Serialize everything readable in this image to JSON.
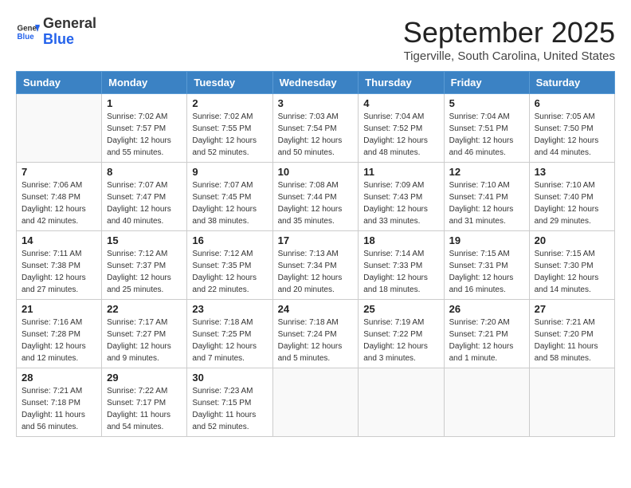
{
  "header": {
    "logo_general": "General",
    "logo_blue": "Blue",
    "month_title": "September 2025",
    "location": "Tigerville, South Carolina, United States"
  },
  "days_of_week": [
    "Sunday",
    "Monday",
    "Tuesday",
    "Wednesday",
    "Thursday",
    "Friday",
    "Saturday"
  ],
  "weeks": [
    [
      {
        "day": "",
        "info": ""
      },
      {
        "day": "1",
        "info": "Sunrise: 7:02 AM\nSunset: 7:57 PM\nDaylight: 12 hours\nand 55 minutes."
      },
      {
        "day": "2",
        "info": "Sunrise: 7:02 AM\nSunset: 7:55 PM\nDaylight: 12 hours\nand 52 minutes."
      },
      {
        "day": "3",
        "info": "Sunrise: 7:03 AM\nSunset: 7:54 PM\nDaylight: 12 hours\nand 50 minutes."
      },
      {
        "day": "4",
        "info": "Sunrise: 7:04 AM\nSunset: 7:52 PM\nDaylight: 12 hours\nand 48 minutes."
      },
      {
        "day": "5",
        "info": "Sunrise: 7:04 AM\nSunset: 7:51 PM\nDaylight: 12 hours\nand 46 minutes."
      },
      {
        "day": "6",
        "info": "Sunrise: 7:05 AM\nSunset: 7:50 PM\nDaylight: 12 hours\nand 44 minutes."
      }
    ],
    [
      {
        "day": "7",
        "info": "Sunrise: 7:06 AM\nSunset: 7:48 PM\nDaylight: 12 hours\nand 42 minutes."
      },
      {
        "day": "8",
        "info": "Sunrise: 7:07 AM\nSunset: 7:47 PM\nDaylight: 12 hours\nand 40 minutes."
      },
      {
        "day": "9",
        "info": "Sunrise: 7:07 AM\nSunset: 7:45 PM\nDaylight: 12 hours\nand 38 minutes."
      },
      {
        "day": "10",
        "info": "Sunrise: 7:08 AM\nSunset: 7:44 PM\nDaylight: 12 hours\nand 35 minutes."
      },
      {
        "day": "11",
        "info": "Sunrise: 7:09 AM\nSunset: 7:43 PM\nDaylight: 12 hours\nand 33 minutes."
      },
      {
        "day": "12",
        "info": "Sunrise: 7:10 AM\nSunset: 7:41 PM\nDaylight: 12 hours\nand 31 minutes."
      },
      {
        "day": "13",
        "info": "Sunrise: 7:10 AM\nSunset: 7:40 PM\nDaylight: 12 hours\nand 29 minutes."
      }
    ],
    [
      {
        "day": "14",
        "info": "Sunrise: 7:11 AM\nSunset: 7:38 PM\nDaylight: 12 hours\nand 27 minutes."
      },
      {
        "day": "15",
        "info": "Sunrise: 7:12 AM\nSunset: 7:37 PM\nDaylight: 12 hours\nand 25 minutes."
      },
      {
        "day": "16",
        "info": "Sunrise: 7:12 AM\nSunset: 7:35 PM\nDaylight: 12 hours\nand 22 minutes."
      },
      {
        "day": "17",
        "info": "Sunrise: 7:13 AM\nSunset: 7:34 PM\nDaylight: 12 hours\nand 20 minutes."
      },
      {
        "day": "18",
        "info": "Sunrise: 7:14 AM\nSunset: 7:33 PM\nDaylight: 12 hours\nand 18 minutes."
      },
      {
        "day": "19",
        "info": "Sunrise: 7:15 AM\nSunset: 7:31 PM\nDaylight: 12 hours\nand 16 minutes."
      },
      {
        "day": "20",
        "info": "Sunrise: 7:15 AM\nSunset: 7:30 PM\nDaylight: 12 hours\nand 14 minutes."
      }
    ],
    [
      {
        "day": "21",
        "info": "Sunrise: 7:16 AM\nSunset: 7:28 PM\nDaylight: 12 hours\nand 12 minutes."
      },
      {
        "day": "22",
        "info": "Sunrise: 7:17 AM\nSunset: 7:27 PM\nDaylight: 12 hours\nand 9 minutes."
      },
      {
        "day": "23",
        "info": "Sunrise: 7:18 AM\nSunset: 7:25 PM\nDaylight: 12 hours\nand 7 minutes."
      },
      {
        "day": "24",
        "info": "Sunrise: 7:18 AM\nSunset: 7:24 PM\nDaylight: 12 hours\nand 5 minutes."
      },
      {
        "day": "25",
        "info": "Sunrise: 7:19 AM\nSunset: 7:22 PM\nDaylight: 12 hours\nand 3 minutes."
      },
      {
        "day": "26",
        "info": "Sunrise: 7:20 AM\nSunset: 7:21 PM\nDaylight: 12 hours\nand 1 minute."
      },
      {
        "day": "27",
        "info": "Sunrise: 7:21 AM\nSunset: 7:20 PM\nDaylight: 11 hours\nand 58 minutes."
      }
    ],
    [
      {
        "day": "28",
        "info": "Sunrise: 7:21 AM\nSunset: 7:18 PM\nDaylight: 11 hours\nand 56 minutes."
      },
      {
        "day": "29",
        "info": "Sunrise: 7:22 AM\nSunset: 7:17 PM\nDaylight: 11 hours\nand 54 minutes."
      },
      {
        "day": "30",
        "info": "Sunrise: 7:23 AM\nSunset: 7:15 PM\nDaylight: 11 hours\nand 52 minutes."
      },
      {
        "day": "",
        "info": ""
      },
      {
        "day": "",
        "info": ""
      },
      {
        "day": "",
        "info": ""
      },
      {
        "day": "",
        "info": ""
      }
    ]
  ]
}
